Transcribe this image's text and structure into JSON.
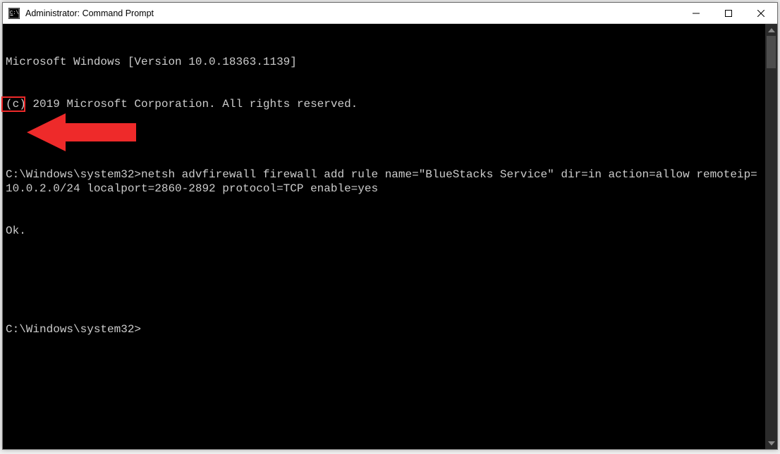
{
  "window": {
    "title": "Administrator: Command Prompt"
  },
  "terminal": {
    "line1": "Microsoft Windows [Version 10.0.18363.1139]",
    "line2": "(c) 2019 Microsoft Corporation. All rights reserved.",
    "blank1": "",
    "cmd_line_full": "C:\\Windows\\system32>netsh advfirewall firewall add rule name=\"BlueStacks Service\" dir=in action=allow remoteip=10.0.2.0/24 localport=2860-2892 protocol=TCP enable=yes",
    "ok_line": "Ok.",
    "blank2": "",
    "blank3": "",
    "prompt2": "C:\\Windows\\system32>"
  }
}
